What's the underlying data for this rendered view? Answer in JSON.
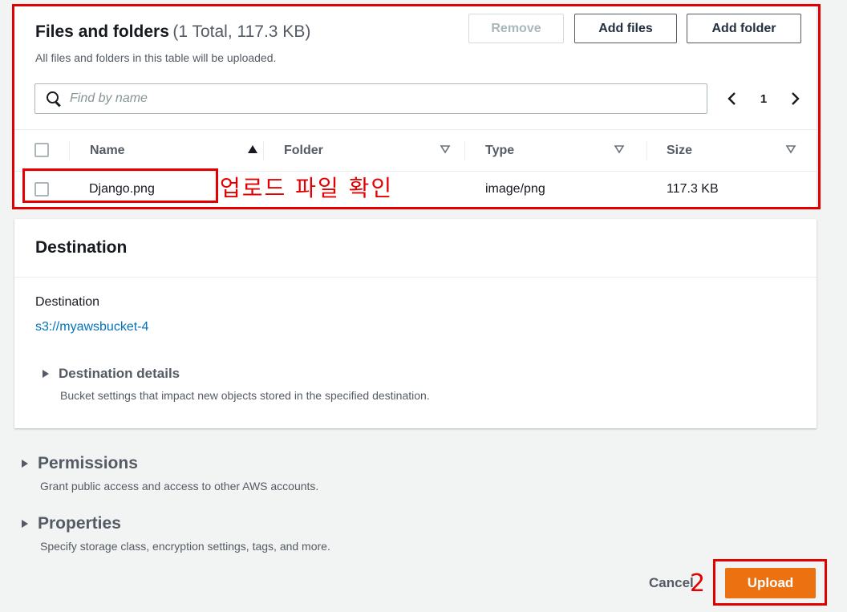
{
  "files_panel": {
    "title": "Files and folders",
    "count": "(1 Total, 117.3 KB)",
    "description": "All files and folders in this table will be uploaded.",
    "remove_label": "Remove",
    "add_files_label": "Add files",
    "add_folder_label": "Add folder",
    "search": {
      "placeholder": "Find by name",
      "value": ""
    },
    "pagination": {
      "current_page": "1"
    },
    "columns": [
      "Name",
      "Folder",
      "Type",
      "Size"
    ],
    "rows": [
      {
        "name": "Django.png",
        "folder": "",
        "type": "image/png",
        "size": "117.3 KB"
      }
    ]
  },
  "destination_panel": {
    "title": "Destination",
    "label": "Destination",
    "bucket_link": "s3://myawsbucket-4",
    "details_title": "Destination details",
    "details_description": "Bucket settings that impact new objects stored in the specified destination."
  },
  "permissions": {
    "title": "Permissions",
    "description": "Grant public access and access to other AWS accounts."
  },
  "properties": {
    "title": "Properties",
    "description": "Specify storage class, encryption settings, tags, and more."
  },
  "footer": {
    "cancel_label": "Cancel",
    "upload_label": "Upload"
  },
  "annotations": {
    "file_note": "업로드 파일 확인",
    "step_number": "2",
    "color": "#e40000"
  },
  "colors": {
    "primary_button": "#ec7211",
    "link": "#0073bb",
    "background": "#f2f3f3"
  }
}
